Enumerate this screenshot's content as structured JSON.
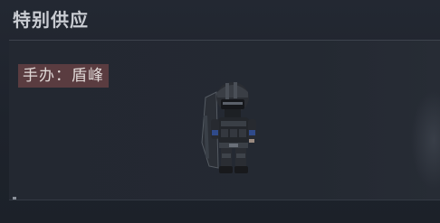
{
  "header": {
    "title": "特别供应"
  },
  "item": {
    "name_label": "手办：盾峰",
    "image_icon": "riot-shield-soldier-figure"
  }
}
